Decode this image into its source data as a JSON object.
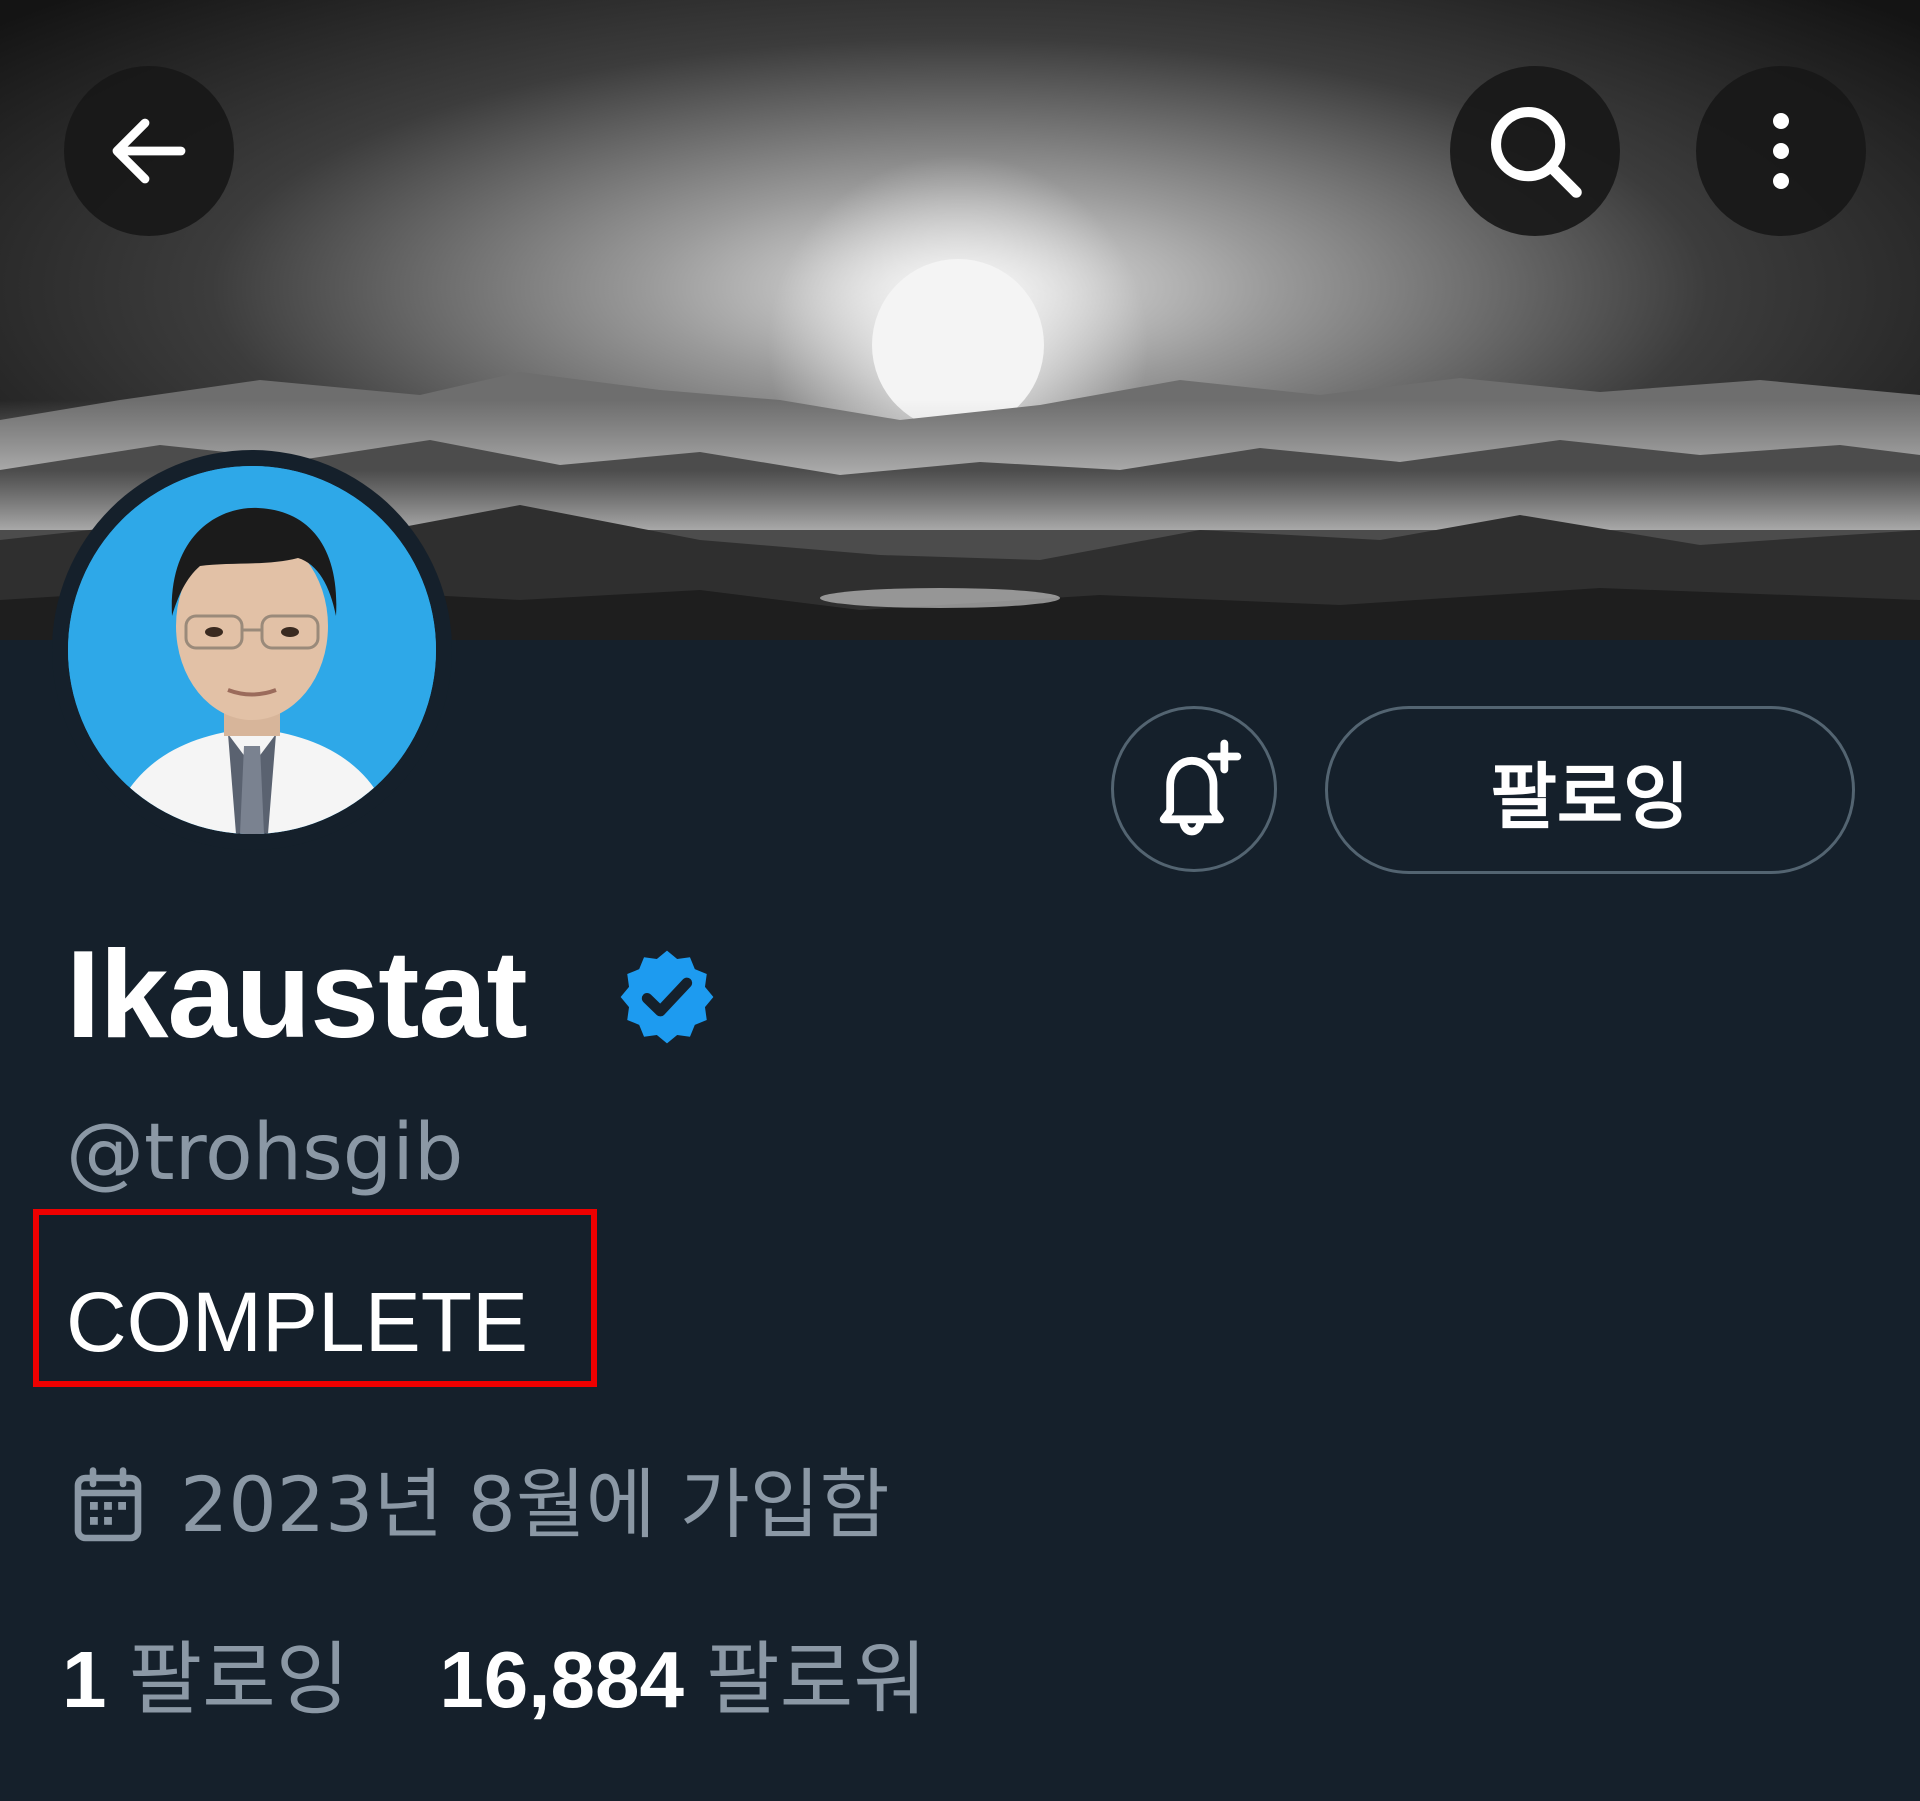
{
  "header": {
    "back_icon": "arrow-left-icon",
    "search_icon": "search-icon",
    "more_icon": "more-vertical-icon"
  },
  "profile": {
    "display_name": "Ikaustat",
    "verified_icon": "verified-badge-icon",
    "handle": "@trohsgib",
    "bio": "COMPLETE",
    "joined": "2023년 8월에 가입함",
    "joined_icon": "calendar-icon",
    "following_count": "1",
    "following_label": "팔로잉",
    "followers_count": "16,884",
    "followers_label": "팔로워"
  },
  "actions": {
    "notify_icon": "bell-plus-icon",
    "follow_label": "팔로잉"
  },
  "colors": {
    "background": "#15202b",
    "secondary_text": "#8b98a5",
    "verified": "#1d9bf0",
    "highlight": "#ee0000"
  }
}
